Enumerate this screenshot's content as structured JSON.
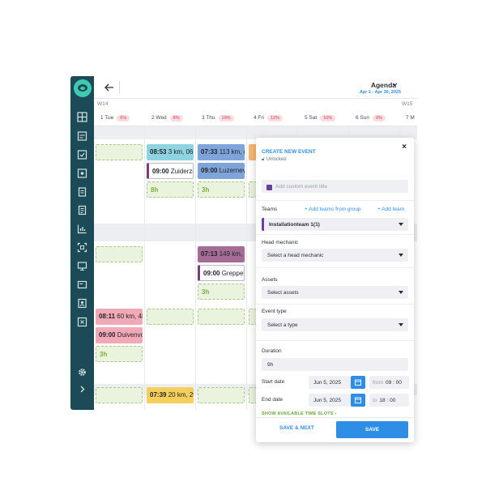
{
  "header": {
    "title": "Agenda",
    "date_range": "Apr 1 - Apr 30, 2025"
  },
  "weeks": [
    "W14",
    "W15"
  ],
  "days": [
    {
      "label": "1 Tue",
      "pct": "6%"
    },
    {
      "label": "2 Wed",
      "pct": "8%"
    },
    {
      "label": "3 Thu",
      "pct": "19%"
    },
    {
      "label": "4 Fri",
      "pct": "12%"
    },
    {
      "label": "5 Sat",
      "pct": "10%"
    },
    {
      "label": "6 Sun",
      "pct": "0%"
    },
    {
      "label": "7 M",
      "pct": ""
    }
  ],
  "events": {
    "e1": {
      "time": "08:53",
      "text": "3 km, 06",
      "color": "#8fd2e0"
    },
    "e2": {
      "time": "09:00",
      "text": "Zuiderze"
    },
    "e3": {
      "time": "07:33",
      "text": "113 km, (",
      "color": "#7fa4d9"
    },
    "e4": {
      "time": "09:00",
      "text": "Luzernev",
      "color": "#7fa4d9"
    },
    "e5": {
      "time": "07:13",
      "text": "149 km, (",
      "color": "#a56d95"
    },
    "e6": {
      "time": "09:00",
      "text": "Greppelr"
    },
    "e7": {
      "time": "08:11",
      "text": "60 km, 48",
      "color": "#f2a9b7"
    },
    "e8": {
      "time": "09:00",
      "text": "Duivenvo",
      "color": "#f2a9b7"
    },
    "e9": {
      "time": "07:39",
      "text": "20 km, 20",
      "color": "#f5cf5b"
    }
  },
  "slot_labels": {
    "wed": "8h",
    "thu1": "3h",
    "thu2": "3h",
    "tue": "3h"
  },
  "panel": {
    "title": "CREATE NEW EVENT",
    "lock_status": "Unlocked",
    "close": "×",
    "event_title_placeholder": "Add custom event title",
    "teams_label": "Teams",
    "add_from_group": "+ Add teams from group",
    "add_team": "+ Add team",
    "team_value": "Installationteam 1(1)",
    "head_mechanic_label": "Head mechanic",
    "head_mechanic_value": "Select a head mechanic",
    "assets_label": "Assets",
    "assets_value": "Select assets",
    "event_type_label": "Event type",
    "event_type_value": "Select a type",
    "duration_label": "Duration",
    "duration_value": "9h",
    "start_label": "Start date",
    "start_date": "Jun 5, 2025",
    "start_time_prefix": "from",
    "start_time": "09 : 00",
    "end_label": "End date",
    "end_date": "Jun 5, 2025",
    "end_time_prefix": "to",
    "end_time": "18 : 00",
    "show_slots": "SHOW AVAILABLE TIME SLOTS ›",
    "save_next": "SAVE & NEXT",
    "save": "SAVE"
  },
  "colors": {
    "sidebar": "#1c4b57",
    "accent": "#2e8ee6",
    "team": "#6b3fa0"
  }
}
